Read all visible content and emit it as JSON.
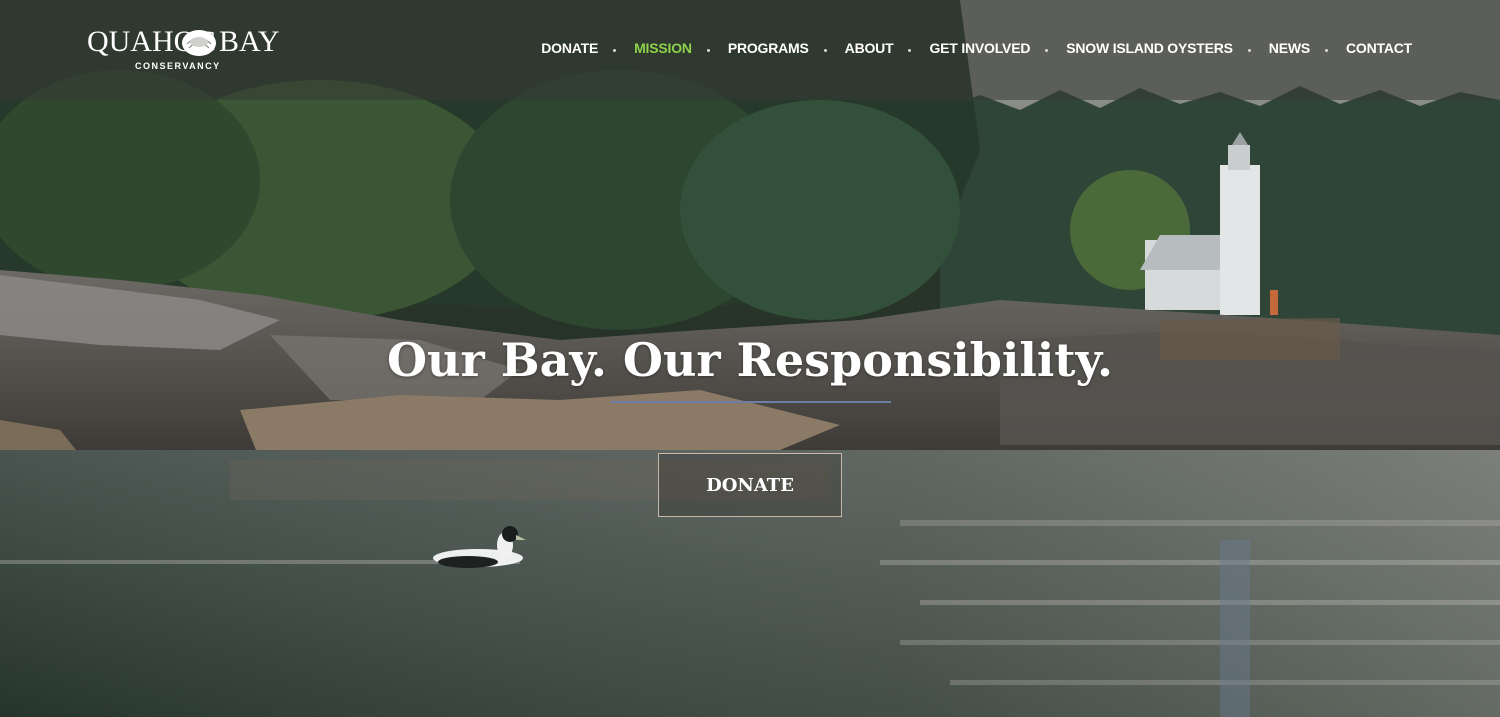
{
  "logo": {
    "word_left": "QUAHOG",
    "word_right": "BAY",
    "subtitle": "CONSERVANCY"
  },
  "nav": {
    "items": [
      {
        "label": "DONATE",
        "active": false
      },
      {
        "label": "MISSION",
        "active": true
      },
      {
        "label": "PROGRAMS",
        "active": false
      },
      {
        "label": "ABOUT",
        "active": false
      },
      {
        "label": "GET INVOLVED",
        "active": false
      },
      {
        "label": "SNOW ISLAND OYSTERS",
        "active": false
      },
      {
        "label": "NEWS",
        "active": false
      },
      {
        "label": "CONTACT",
        "active": false
      }
    ]
  },
  "hero": {
    "title": "Our Bay. Our Responsibility.",
    "cta_label": "DONATE"
  },
  "colors": {
    "active_nav": "#8ed14a",
    "accent_rule": "#6e7ea6",
    "header_overlay": "#373a34"
  },
  "icons": {
    "logo_shell": "quahog-shell-icon"
  }
}
